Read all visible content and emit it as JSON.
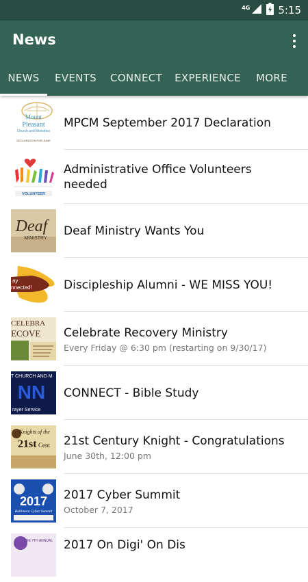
{
  "status": {
    "network": "4G",
    "time": "5:15"
  },
  "appbar": {
    "title": "News"
  },
  "tabs": [
    {
      "label": "NEWS",
      "active": true
    },
    {
      "label": "EVENTS",
      "active": false
    },
    {
      "label": "CONNECT",
      "active": false
    },
    {
      "label": "EXPERIENCE",
      "active": false
    },
    {
      "label": "MORE",
      "active": false
    }
  ],
  "items": [
    {
      "title": "MPCM September 2017 Declaration",
      "subtitle": "",
      "thumb_text": [
        "Mount",
        "Pleasant",
        "Church and Ministries",
        "DECLARATION FOR JUNE"
      ]
    },
    {
      "title": "Administrative Office Volunteers needed",
      "subtitle": "",
      "thumb_text": [
        "VOLUNTEER"
      ]
    },
    {
      "title": "Deaf Ministry Wants You",
      "subtitle": "",
      "thumb_text": [
        "Deaf",
        "MINISTRY"
      ]
    },
    {
      "title": "Discipleship Alumni - WE MISS YOU!",
      "subtitle": "",
      "thumb_text": [
        "ay",
        "nnected!"
      ]
    },
    {
      "title": "Celebrate Recovery Ministry",
      "subtitle": "Every Friday @ 6:30 pm (restarting on 9/30/17)",
      "thumb_text": [
        "CELEBRA",
        "ECOVE"
      ]
    },
    {
      "title": "CONNECT - Bible Study",
      "subtitle": "",
      "thumb_text": [
        "T CHURCH AND M",
        "NN",
        "rayer Service"
      ]
    },
    {
      "title": "21st Century Knight  - Congratulations",
      "subtitle": "June 30th, 12:00 pm",
      "thumb_text": [
        "Knights of the",
        "21st",
        "Cent"
      ]
    },
    {
      "title": "2017 Cyber Summit",
      "subtitle": "October 7, 2017",
      "thumb_text": [
        "2017",
        "Baltimore Cyber Summit"
      ]
    },
    {
      "title": "2017 On Digi' On Dis",
      "subtitle": "",
      "thumb_text": [
        "THE 7TH ANNUAL"
      ]
    }
  ]
}
